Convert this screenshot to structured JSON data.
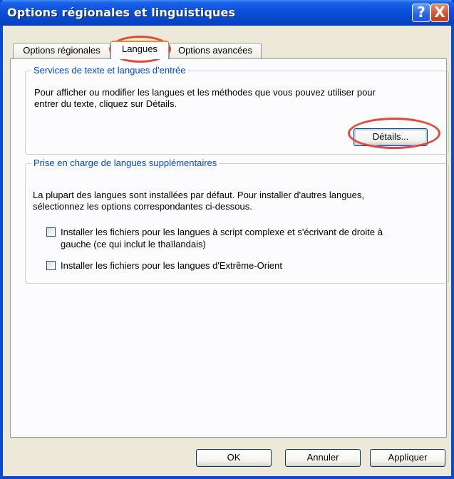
{
  "window": {
    "title": "Options régionales et linguistiques",
    "help_symbol": "?",
    "close_symbol": "X"
  },
  "tabs": [
    {
      "label": "Options régionales",
      "active": false
    },
    {
      "label": "Langues",
      "active": true
    },
    {
      "label": "Options avancées",
      "active": false
    }
  ],
  "group_text_services": {
    "legend": "Services de texte et langues d'entrée",
    "description_line1": "Pour afficher ou modifier les langues et les méthodes que vous pouvez utiliser pour",
    "description_line2": "entrer du texte, cliquez sur Détails.",
    "details_button": "Détails..."
  },
  "group_supplemental": {
    "legend": "Prise en charge de langues supplémentaires",
    "description_line1": "La plupart des langues sont installées par défaut. Pour installer d'autres langues,",
    "description_line2": "sélectionnez les options correspondantes ci-dessous.",
    "checkbox_complex_line1": "Installer les fichiers pour les langues à script complexe et s'écrivant de droite à",
    "checkbox_complex_line2": "gauche (ce qui inclut le thaïlandais)",
    "checkbox_complex_checked": false,
    "checkbox_east_asian": "Installer les fichiers pour les langues d'Extrême-Orient",
    "checkbox_east_asian_checked": false
  },
  "footer": {
    "ok": "OK",
    "cancel": "Annuler",
    "apply": "Appliquer"
  },
  "colors": {
    "titlebar": "#0a4fd9",
    "group_legend": "#0046d5",
    "highlight_circle": "#e04a3a",
    "dialog_bg": "#ece9d8"
  }
}
